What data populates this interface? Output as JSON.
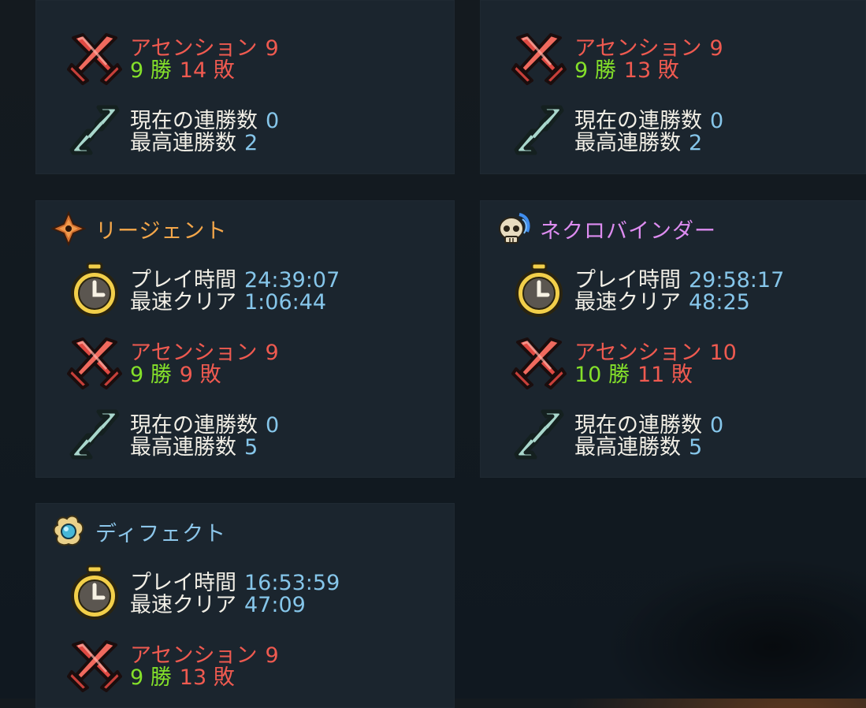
{
  "icons": {
    "swords": "crossed-swords-icon",
    "chain": "chain-link-icon",
    "clock": "stopwatch-icon",
    "regent": "regent-crest-icon",
    "necro": "skull-icon",
    "defect": "orb-icon"
  },
  "colors": {
    "label": "#f2efe6",
    "value": "#86c6ea",
    "ascension": "#ef5a50",
    "wins": "#84e02a",
    "regent_name": "#f5a74a",
    "necro_name": "#dd8cf0",
    "defect_name": "#8cc6ea"
  },
  "labels": {
    "playtime": "プレイ時間",
    "fastest": "最速クリア",
    "ascension": "アセンション",
    "win_suffix": "勝",
    "loss_suffix": "敗",
    "current_streak": "現在の連勝数",
    "best_streak": "最高連勝数"
  },
  "cards": {
    "top_left": {
      "ascension": "9",
      "wins": "9",
      "losses": "14",
      "current_streak": "0",
      "best_streak": "2"
    },
    "top_right": {
      "ascension": "9",
      "wins": "9",
      "losses": "13",
      "current_streak": "0",
      "best_streak": "2"
    },
    "regent": {
      "name": "リージェント",
      "playtime": "24:39:07",
      "fastest": "1:06:44",
      "ascension": "9",
      "wins": "9",
      "losses": "9",
      "current_streak": "0",
      "best_streak": "5"
    },
    "necrobinder": {
      "name": "ネクロバインダー",
      "playtime": "29:58:17",
      "fastest": "48:25",
      "ascension": "10",
      "wins": "10",
      "losses": "11",
      "current_streak": "0",
      "best_streak": "5"
    },
    "defect": {
      "name": "ディフェクト",
      "playtime": "16:53:59",
      "fastest": "47:09",
      "ascension": "9",
      "wins": "9",
      "losses": "13"
    }
  }
}
